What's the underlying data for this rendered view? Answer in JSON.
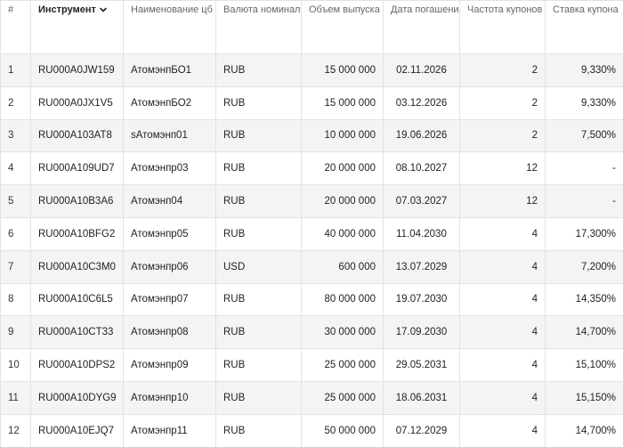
{
  "table": {
    "headers": {
      "num": "#",
      "instrument": "Инструмент",
      "name": "Наименование цб",
      "currency": "Валюта номинала",
      "volume": "Объем выпуска",
      "maturity": "Дата погашения",
      "frequency": "Частота купонов",
      "rate": "Ставка купона"
    },
    "sort_icon": "chevron-down-icon",
    "rows": [
      {
        "num": "1",
        "instrument": "RU000A0JW159",
        "name": "АтомэнпБО1",
        "currency": "RUB",
        "volume": "15 000 000",
        "maturity": "02.11.2026",
        "frequency": "2",
        "rate": "9,330%"
      },
      {
        "num": "2",
        "instrument": "RU000A0JX1V5",
        "name": "АтомэнпБО2",
        "currency": "RUB",
        "volume": "15 000 000",
        "maturity": "03.12.2026",
        "frequency": "2",
        "rate": "9,330%"
      },
      {
        "num": "3",
        "instrument": "RU000A103AT8",
        "name": "sАтомэнп01",
        "currency": "RUB",
        "volume": "10 000 000",
        "maturity": "19.06.2026",
        "frequency": "2",
        "rate": "7,500%"
      },
      {
        "num": "4",
        "instrument": "RU000A109UD7",
        "name": "Атомэнпр03",
        "currency": "RUB",
        "volume": "20 000 000",
        "maturity": "08.10.2027",
        "frequency": "12",
        "rate": "-"
      },
      {
        "num": "5",
        "instrument": "RU000A10B3A6",
        "name": "Атомэнп04",
        "currency": "RUB",
        "volume": "20 000 000",
        "maturity": "07.03.2027",
        "frequency": "12",
        "rate": "-"
      },
      {
        "num": "6",
        "instrument": "RU000A10BFG2",
        "name": "Атомэнпр05",
        "currency": "RUB",
        "volume": "40 000 000",
        "maturity": "11.04.2030",
        "frequency": "4",
        "rate": "17,300%"
      },
      {
        "num": "7",
        "instrument": "RU000A10C3M0",
        "name": "Атомэнпр06",
        "currency": "USD",
        "volume": "600 000",
        "maturity": "13.07.2029",
        "frequency": "4",
        "rate": "7,200%"
      },
      {
        "num": "8",
        "instrument": "RU000A10C6L5",
        "name": "Атомэнпр07",
        "currency": "RUB",
        "volume": "80 000 000",
        "maturity": "19.07.2030",
        "frequency": "4",
        "rate": "14,350%"
      },
      {
        "num": "9",
        "instrument": "RU000A10CT33",
        "name": "Атомэнпр08",
        "currency": "RUB",
        "volume": "30 000 000",
        "maturity": "17.09.2030",
        "frequency": "4",
        "rate": "14,700%"
      },
      {
        "num": "10",
        "instrument": "RU000A10DPS2",
        "name": "Атомэнпр09",
        "currency": "RUB",
        "volume": "25 000 000",
        "maturity": "29.05.2031",
        "frequency": "4",
        "rate": "15,100%"
      },
      {
        "num": "11",
        "instrument": "RU000A10DYG9",
        "name": "Атомэнпр10",
        "currency": "RUB",
        "volume": "25 000 000",
        "maturity": "18.06.2031",
        "frequency": "4",
        "rate": "15,150%"
      },
      {
        "num": "12",
        "instrument": "RU000A10EJQ7",
        "name": "Атомэнпр11",
        "currency": "RUB",
        "volume": "50 000 000",
        "maturity": "07.12.2029",
        "frequency": "4",
        "rate": "14,700%"
      }
    ]
  }
}
